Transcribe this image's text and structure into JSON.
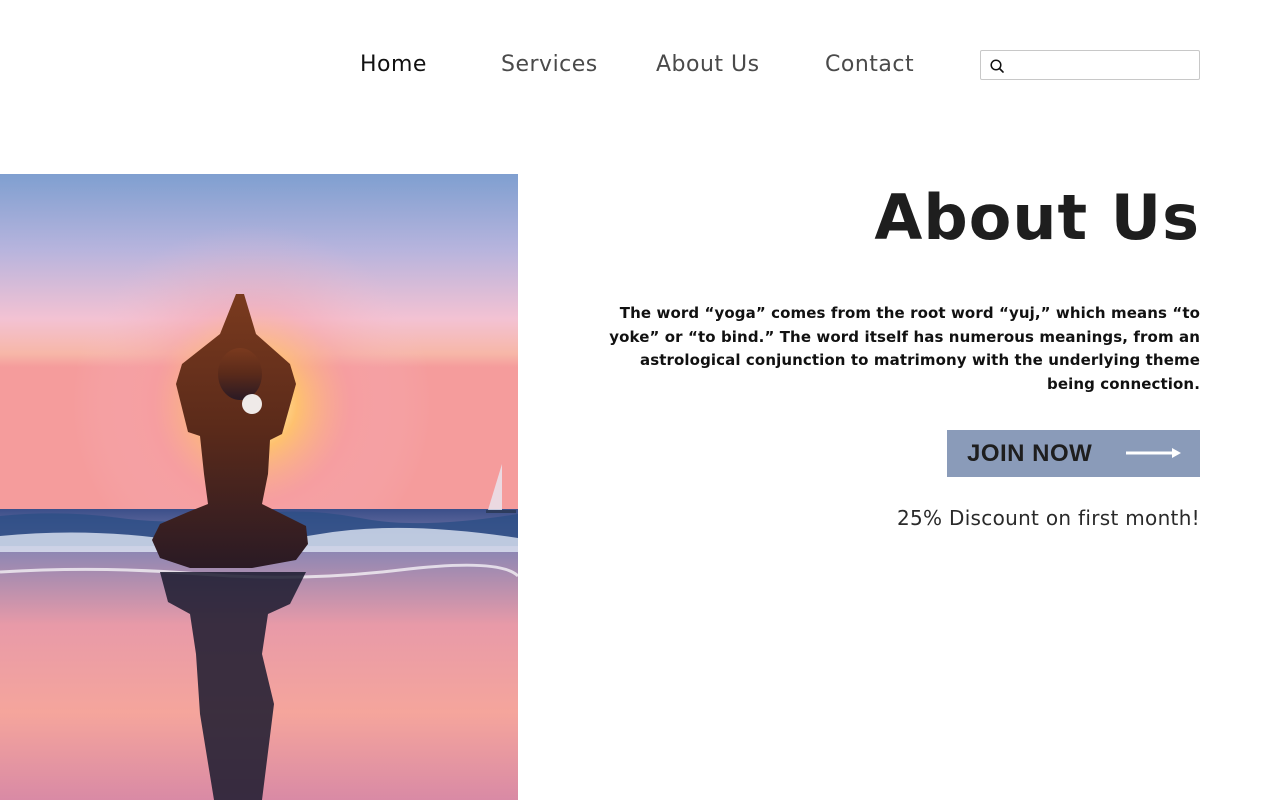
{
  "nav": {
    "links": [
      {
        "label": "Home"
      },
      {
        "label": "Services"
      },
      {
        "label": "About Us"
      },
      {
        "label": "Contact"
      }
    ],
    "search": {
      "placeholder": "",
      "value": "",
      "icon": "search-icon"
    }
  },
  "hero": {
    "image": "yoga-silhouette-beach-sunset-photo"
  },
  "about": {
    "title": "About Us",
    "body": "The word “yoga” comes from the root word “yuj,” which means “to yoke” or “to bind.” The word itself has numerous meanings, from an astrological conjunction to matrimony  with the underlying theme being connection.",
    "cta_label": "JOIN NOW",
    "cta_icon": "arrow-right-icon",
    "discount": "25% Discount on first month!"
  },
  "colors": {
    "button_bg": "#8a9bb9",
    "title": "#1e1e1e"
  }
}
